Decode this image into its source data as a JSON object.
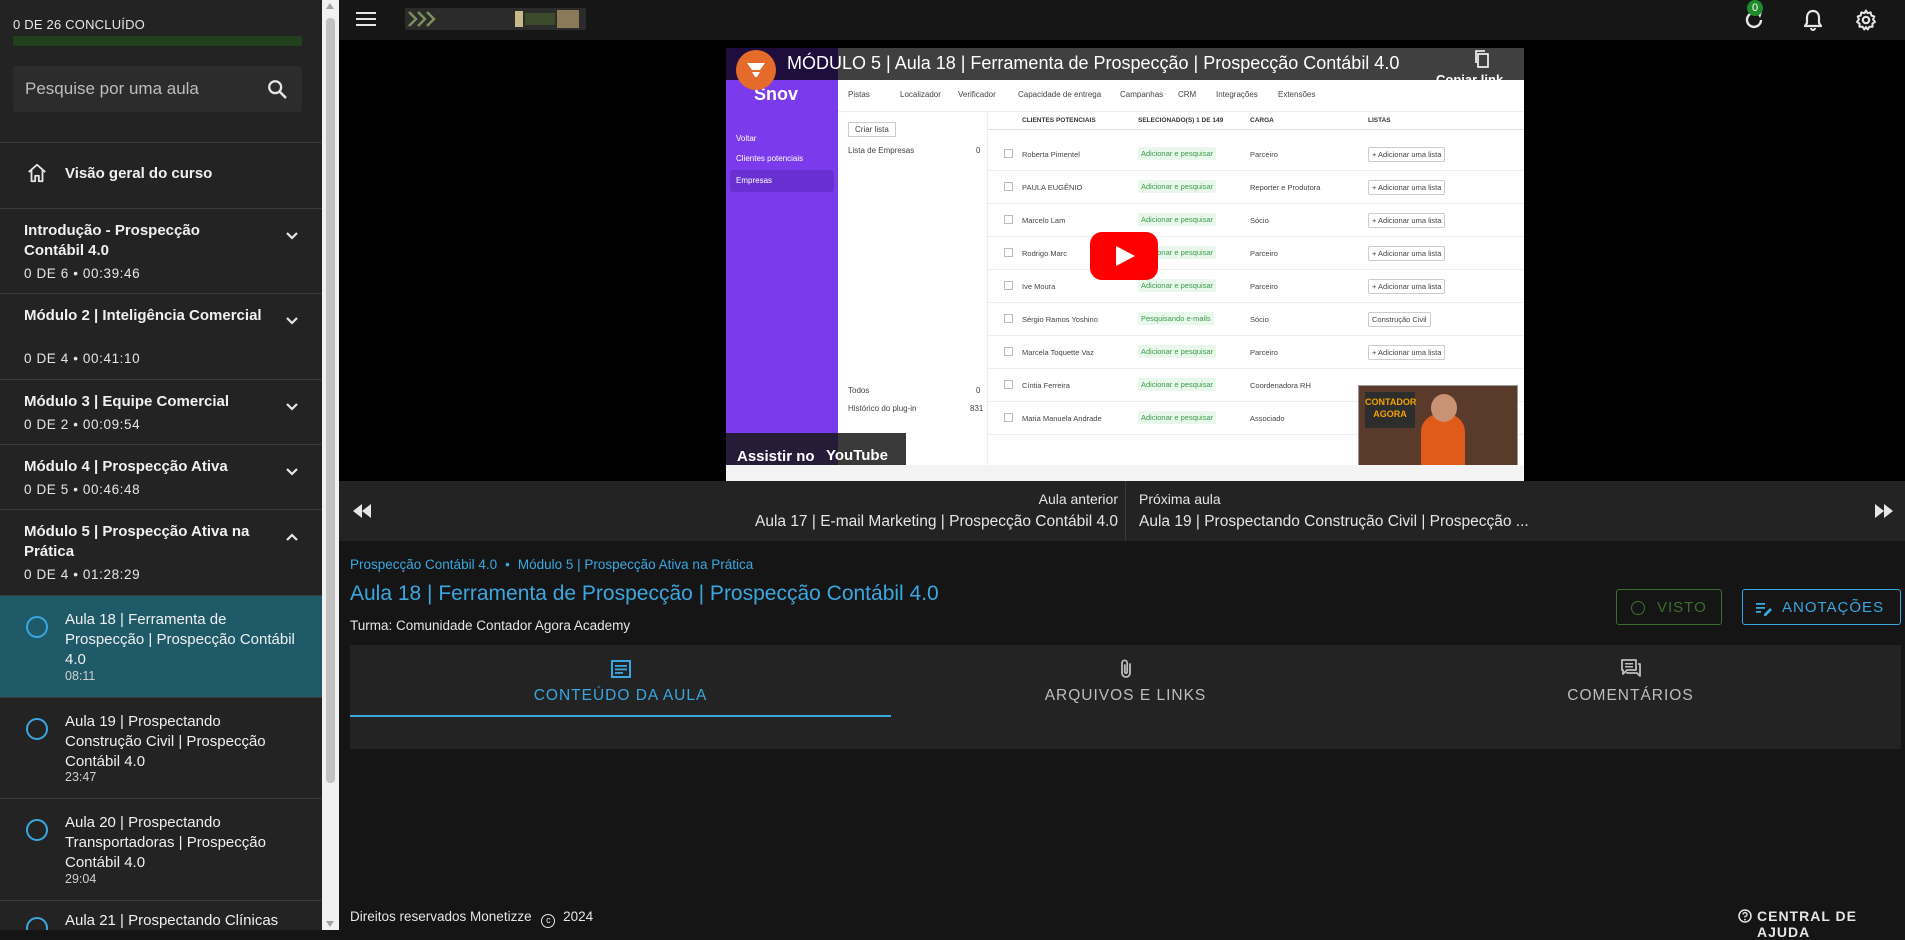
{
  "sidebar": {
    "progress_label": "0 DE 26 CONCLUÍDO",
    "progress_fraction": 0,
    "search_placeholder": "Pesquise por uma aula",
    "overview_label": "Visão geral do curso",
    "modules": [
      {
        "title": "Introdução - Prospecção Contábil 4.0",
        "meta": "0 DE 6 • 00:39:46",
        "expanded": false
      },
      {
        "title": "Módulo 2 | Inteligência Comercial",
        "meta": "0 DE 4 • 00:41:10",
        "expanded": false
      },
      {
        "title": "Módulo 3 | Equipe Comercial",
        "meta": "0 DE 2 • 00:09:54",
        "expanded": false
      },
      {
        "title": "Módulo 4 | Prospecção Ativa",
        "meta": "0 DE 5 • 00:46:48",
        "expanded": false
      },
      {
        "title": "Módulo 5 | Prospecção Ativa na Prática",
        "meta": "0 DE 4 • 01:28:29",
        "expanded": true
      }
    ],
    "lessons": [
      {
        "title": "Aula 18 | Ferramenta de Prospecção | Prospecção Contábil 4.0",
        "duration": "08:11",
        "active": true
      },
      {
        "title": "Aula 19 | Prospectando Construção Civil | Prospecção Contábil 4.0",
        "duration": "23:47",
        "active": false
      },
      {
        "title": "Aula 20 | Prospectando Transportadoras | Prospecção Contábil 4.0",
        "duration": "29:04",
        "active": false
      },
      {
        "title": "Aula 21 | Prospectando Clínicas",
        "duration": "",
        "active": false
      }
    ]
  },
  "topbar": {
    "notification_count": "0",
    "icons": [
      "menu-icon",
      "refresh-icon",
      "bell-icon",
      "gear-icon"
    ]
  },
  "video": {
    "title": "MÓDULO 5 | Aula 18 | Ferramenta de Prospecção | Prospecção Contábil 4.0",
    "copy_link": "Copiar link",
    "watch_on": "Assistir no",
    "youtube": "YouTube",
    "screen": {
      "brand": "Snov",
      "nav": [
        "Pistas",
        "Localizador",
        "Verificador",
        "Capacidade de entrega",
        "Campanhas",
        "CRM",
        "Integrações",
        "Extensões"
      ],
      "side_items": [
        "Voltar",
        "Clientes potenciais",
        "Empresas"
      ],
      "create_list": "Criar lista",
      "list_name": "Lista de Empresas",
      "list_count": "0",
      "bottom_items": [
        "Todos",
        "Histórico do plug-in"
      ],
      "bottom_counts": [
        "0",
        "831"
      ],
      "headers": [
        "CLIENTES POTENCIAIS",
        "SELECIONADO(S) 1 DE 149",
        "CARGA",
        "LISTAS"
      ],
      "rows": [
        {
          "name": "Roberta Pimentel",
          "status": "Adicionar e pesquisar",
          "role": "Parceiro",
          "list": "+ Adicionar uma lista"
        },
        {
          "name": "PAULA EUGÊNIO",
          "status": "Adicionar e pesquisar",
          "role": "Reporter e Produtora",
          "list": "+ Adicionar uma lista"
        },
        {
          "name": "Marcelo Lam",
          "status": "Adicionar e pesquisar",
          "role": "Sócio",
          "list": "+ Adicionar uma lista"
        },
        {
          "name": "Rodrigo Marc",
          "status": "Adicionar e pesquisar",
          "role": "Parceiro",
          "list": "+ Adicionar uma lista"
        },
        {
          "name": "Ive Moura",
          "status": "Adicionar e pesquisar",
          "role": "Parceiro",
          "list": "+ Adicionar uma lista"
        },
        {
          "name": "Sérgio Ramos Yoshino",
          "status": "Pesquisando e-mails",
          "role": "Sócio",
          "list": "Construção Civil"
        },
        {
          "name": "Marcela Toquette Vaz",
          "status": "Adicionar e pesquisar",
          "role": "Parceiro",
          "list": "+ Adicionar uma lista"
        },
        {
          "name": "Cíntia Ferreira",
          "status": "Adicionar e pesquisar",
          "role": "Coordenadora RH",
          "list": ""
        },
        {
          "name": "Maria Manuela Andrade",
          "status": "Adicionar e pesquisar",
          "role": "Associado",
          "list": ""
        }
      ],
      "facecam_sign": "CONTADOR AGORA"
    }
  },
  "navigation": {
    "prev_caption": "Aula anterior",
    "prev_title": "Aula 17 | E-mail Marketing | Prospecção Contábil 4.0",
    "next_caption": "Próxima aula",
    "next_title": "Aula 19 | Prospectando Construção Civil | Prospecção ..."
  },
  "main": {
    "breadcrumb": [
      "Prospecção Contábil 4.0",
      "Módulo 5 | Prospecção Ativa na Prática"
    ],
    "breadcrumb_sep": "•",
    "title": "Aula 18 | Ferramenta de Prospecção | Prospecção Contábil 4.0",
    "turma": "Turma: Comunidade Contador Agora Academy",
    "visto_label": "VISTO",
    "notes_label": "ANOTAÇÕES",
    "tabs": [
      {
        "label": "CONTEÚDO DA AULA",
        "active": true
      },
      {
        "label": "ARQUIVOS E LINKS",
        "active": false
      },
      {
        "label": "COMENTÁRIOS",
        "active": false
      }
    ]
  },
  "footer": {
    "rights": "Direitos reservados Monetizze",
    "year": "2024",
    "help": "CENTRAL DE AJUDA"
  },
  "colors": {
    "accent": "#3aa7e0",
    "visto_green": "#3c6e2e",
    "active_lesson_bg": "#1f5a69",
    "sidebar_bg": "#232323",
    "page_bg": "#151515"
  }
}
